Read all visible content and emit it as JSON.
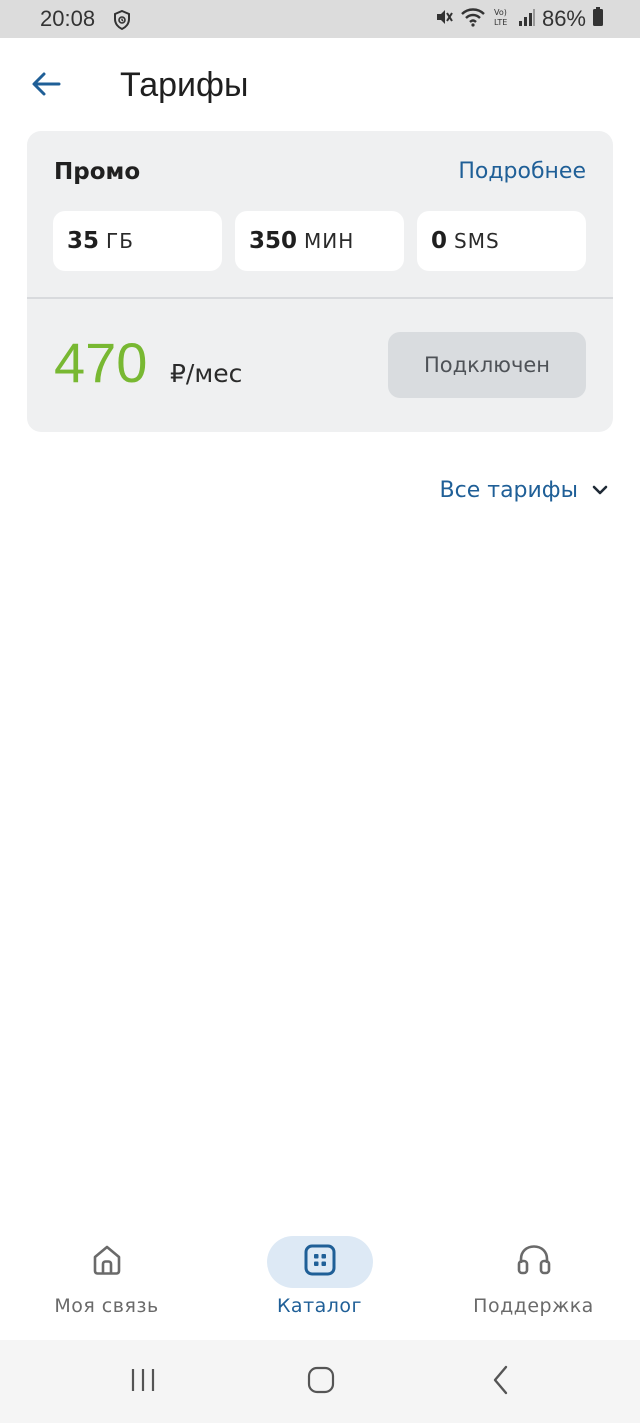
{
  "status_bar": {
    "time": "20:08",
    "battery": "86%",
    "icons": [
      "shield-icon",
      "mute-icon",
      "wifi-icon",
      "volte-icon",
      "signal-icon",
      "battery-icon"
    ]
  },
  "header": {
    "title": "Тарифы",
    "back_icon": "arrow-left-icon"
  },
  "tariff": {
    "name": "Промо",
    "details_link": "Подробнее",
    "quotas": [
      {
        "value": "35",
        "unit": "ГБ"
      },
      {
        "value": "350",
        "unit": "МИН"
      },
      {
        "value": "0",
        "unit": "SMS"
      }
    ],
    "price": "470",
    "price_unit": "₽/мес",
    "status_button": "Подключен"
  },
  "all_tariffs": {
    "label": "Все тарифы",
    "icon": "chevron-down-icon"
  },
  "bottom_nav": {
    "items": [
      {
        "label": "Моя связь",
        "icon": "home-icon",
        "active": false
      },
      {
        "label": "Каталог",
        "icon": "catalog-icon",
        "active": true
      },
      {
        "label": "Поддержка",
        "icon": "headset-icon",
        "active": false
      }
    ]
  },
  "colors": {
    "accent": "#1f5f97",
    "price_green": "#78b832",
    "card_bg": "#eff0f1",
    "active_pill": "#dde9f5"
  }
}
